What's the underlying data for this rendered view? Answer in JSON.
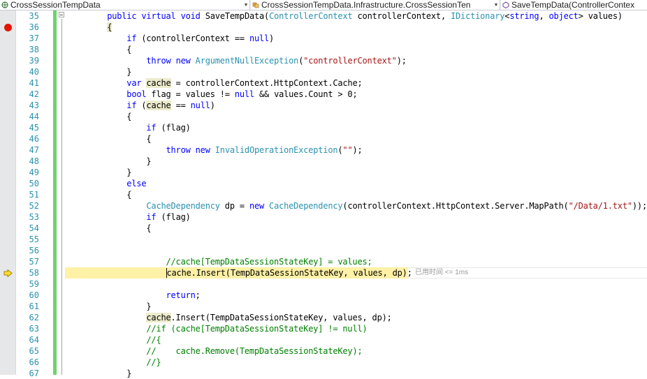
{
  "nav": {
    "project_dropdown": "CrossSessionTempData",
    "type_dropdown": "CrossSessionTempData.Infrastructure.CrossSessionTen",
    "member_dropdown": "SaveTempData(ControllerContex"
  },
  "colors": {
    "keyword": "#0000ff",
    "type": "#2b91af",
    "string": "#a31515",
    "comment": "#008000",
    "breakpoint": "#e51400",
    "current_statement": "#fff1a6",
    "changed_lines": "#6bd46b"
  },
  "perf_tip": "已用时间 <= 1ms",
  "lines": [
    {
      "n": "35",
      "tokens": [
        {
          "t": "        "
        },
        {
          "t": "public",
          "c": "kw"
        },
        {
          "t": " "
        },
        {
          "t": "virtual",
          "c": "kw"
        },
        {
          "t": " "
        },
        {
          "t": "void",
          "c": "kw"
        },
        {
          "t": " SaveTempData("
        },
        {
          "t": "ControllerContext",
          "c": "ty"
        },
        {
          "t": " controllerContext, "
        },
        {
          "t": "IDictionary",
          "c": "ty"
        },
        {
          "t": "<"
        },
        {
          "t": "string",
          "c": "kw"
        },
        {
          "t": ", "
        },
        {
          "t": "object",
          "c": "kw"
        },
        {
          "t": "> values)"
        }
      ]
    },
    {
      "n": "36",
      "bp": true,
      "tokens": [
        {
          "t": "        "
        },
        {
          "t": "{",
          "c": "br"
        }
      ]
    },
    {
      "n": "37",
      "tokens": [
        {
          "t": "            "
        },
        {
          "t": "if",
          "c": "kw"
        },
        {
          "t": " (controllerContext == "
        },
        {
          "t": "null",
          "c": "kw"
        },
        {
          "t": ")"
        }
      ]
    },
    {
      "n": "38",
      "tokens": [
        {
          "t": "            {"
        }
      ]
    },
    {
      "n": "39",
      "tokens": [
        {
          "t": "                "
        },
        {
          "t": "throw",
          "c": "kw"
        },
        {
          "t": " "
        },
        {
          "t": "new",
          "c": "kw"
        },
        {
          "t": " "
        },
        {
          "t": "ArgumentNullException",
          "c": "ty"
        },
        {
          "t": "("
        },
        {
          "t": "\"controllerContext\"",
          "c": "st"
        },
        {
          "t": ");"
        }
      ]
    },
    {
      "n": "40",
      "tokens": [
        {
          "t": "            }"
        }
      ]
    },
    {
      "n": "41",
      "tokens": [
        {
          "t": "            "
        },
        {
          "t": "var",
          "c": "kw"
        },
        {
          "t": " "
        },
        {
          "t": "cache",
          "c": "hl"
        },
        {
          "t": " = controllerContext.HttpContext.Cache;"
        }
      ]
    },
    {
      "n": "42",
      "tokens": [
        {
          "t": "            "
        },
        {
          "t": "bool",
          "c": "kw"
        },
        {
          "t": " flag = values != "
        },
        {
          "t": "null",
          "c": "kw"
        },
        {
          "t": " && values.Count > 0;"
        }
      ]
    },
    {
      "n": "43",
      "tokens": [
        {
          "t": "            "
        },
        {
          "t": "if",
          "c": "kw"
        },
        {
          "t": " ("
        },
        {
          "t": "cache",
          "c": "hl"
        },
        {
          "t": " == "
        },
        {
          "t": "null",
          "c": "kw"
        },
        {
          "t": ")"
        }
      ]
    },
    {
      "n": "44",
      "tokens": [
        {
          "t": "            {"
        }
      ]
    },
    {
      "n": "45",
      "tokens": [
        {
          "t": "                "
        },
        {
          "t": "if",
          "c": "kw"
        },
        {
          "t": " (flag)"
        }
      ]
    },
    {
      "n": "46",
      "tokens": [
        {
          "t": "                {"
        }
      ]
    },
    {
      "n": "47",
      "tokens": [
        {
          "t": "                    "
        },
        {
          "t": "throw",
          "c": "kw"
        },
        {
          "t": " "
        },
        {
          "t": "new",
          "c": "kw"
        },
        {
          "t": " "
        },
        {
          "t": "InvalidOperationException",
          "c": "ty"
        },
        {
          "t": "("
        },
        {
          "t": "\"\"",
          "c": "st"
        },
        {
          "t": ");"
        }
      ]
    },
    {
      "n": "48",
      "tokens": [
        {
          "t": "                }"
        }
      ]
    },
    {
      "n": "49",
      "tokens": [
        {
          "t": "            }"
        }
      ]
    },
    {
      "n": "50",
      "tokens": [
        {
          "t": "            "
        },
        {
          "t": "else",
          "c": "kw"
        }
      ]
    },
    {
      "n": "51",
      "tokens": [
        {
          "t": "            {"
        }
      ]
    },
    {
      "n": "52",
      "tokens": [
        {
          "t": "                "
        },
        {
          "t": "CacheDependency",
          "c": "ty"
        },
        {
          "t": " dp = "
        },
        {
          "t": "new",
          "c": "kw"
        },
        {
          "t": " "
        },
        {
          "t": "CacheDependency",
          "c": "ty"
        },
        {
          "t": "(controllerContext.HttpContext.Server.MapPath("
        },
        {
          "t": "\"/Data/1.txt\"",
          "c": "st"
        },
        {
          "t": "));"
        }
      ]
    },
    {
      "n": "53",
      "tokens": [
        {
          "t": "                "
        },
        {
          "t": "if",
          "c": "kw"
        },
        {
          "t": " (flag)"
        }
      ]
    },
    {
      "n": "54",
      "tokens": [
        {
          "t": "                {"
        }
      ]
    },
    {
      "n": "55",
      "tokens": []
    },
    {
      "n": "56",
      "tokens": []
    },
    {
      "n": "57",
      "tokens": [
        {
          "t": "                    "
        },
        {
          "t": "//cache[TempDataSessionStateKey] = values;",
          "c": "cm"
        }
      ]
    },
    {
      "n": "58",
      "exec": true,
      "tokens": [
        {
          "t": "                    "
        },
        {
          "t": "cache",
          "c": "cursor"
        },
        {
          "t": ".Insert(TempDataSessionStateKey, values, dp);"
        }
      ]
    },
    {
      "n": "59",
      "tokens": []
    },
    {
      "n": "60",
      "tokens": [
        {
          "t": "                    "
        },
        {
          "t": "return",
          "c": "kw"
        },
        {
          "t": ";"
        }
      ]
    },
    {
      "n": "61",
      "tokens": [
        {
          "t": "                }"
        }
      ]
    },
    {
      "n": "62",
      "tokens": [
        {
          "t": "                "
        },
        {
          "t": "cache",
          "c": "hl"
        },
        {
          "t": ".Insert(TempDataSessionStateKey, values, dp);"
        }
      ]
    },
    {
      "n": "63",
      "tokens": [
        {
          "t": "                "
        },
        {
          "t": "//if (cache[TempDataSessionStateKey] != null)",
          "c": "cm"
        }
      ]
    },
    {
      "n": "64",
      "tokens": [
        {
          "t": "                "
        },
        {
          "t": "//{",
          "c": "cm"
        }
      ]
    },
    {
      "n": "65",
      "tokens": [
        {
          "t": "                "
        },
        {
          "t": "//    cache.Remove(TempDataSessionStateKey);",
          "c": "cm"
        }
      ]
    },
    {
      "n": "66",
      "tokens": [
        {
          "t": "                "
        },
        {
          "t": "//}",
          "c": "cm"
        }
      ]
    },
    {
      "n": "67",
      "tokens": [
        {
          "t": "            }"
        }
      ]
    }
  ]
}
